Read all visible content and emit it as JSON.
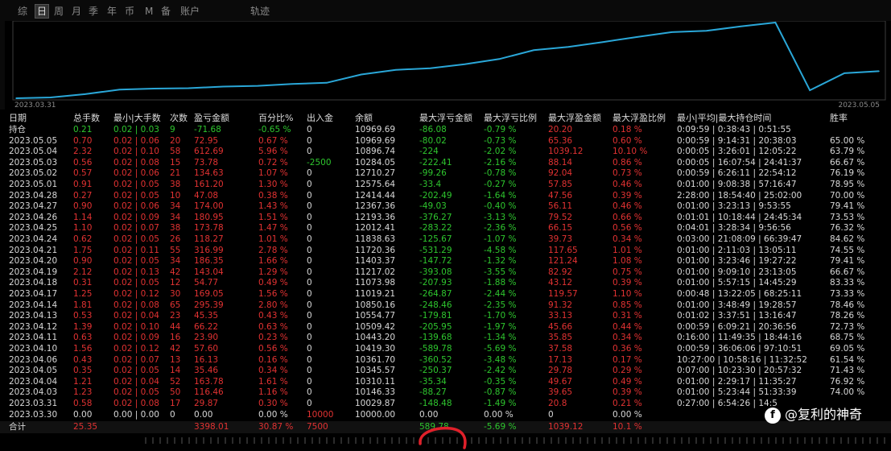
{
  "tabs": [
    "综",
    "日",
    "周",
    "月",
    "季",
    "年",
    "币",
    "M",
    "备",
    "账户",
    "轨迹"
  ],
  "active_tab": "日",
  "chart_data": {
    "type": "line",
    "x": [
      "2023.03.30",
      "2023.03.31",
      "2023.04.03",
      "2023.04.04",
      "2023.04.05",
      "2023.04.06",
      "2023.04.10",
      "2023.04.11",
      "2023.04.12",
      "2023.04.13",
      "2023.04.14",
      "2023.04.17",
      "2023.04.18",
      "2023.04.19",
      "2023.04.20",
      "2023.04.21",
      "2023.04.24",
      "2023.04.25",
      "2023.04.26",
      "2023.04.27",
      "2023.04.28",
      "2023.05.01",
      "2023.05.02",
      "2023.05.03",
      "2023.05.04",
      "2023.05.05"
    ],
    "values": [
      10000.0,
      10029.87,
      10146.33,
      10310.11,
      10345.57,
      10361.7,
      10419.3,
      10443.2,
      10509.42,
      10554.77,
      10850.16,
      11019.21,
      11073.98,
      11217.02,
      11403.37,
      11720.36,
      11838.63,
      12012.41,
      12193.36,
      12367.36,
      12414.44,
      12575.64,
      12710.27,
      10284.05,
      10896.74,
      10969.69
    ],
    "xlabel_start": "2023.03.31",
    "xlabel_end": "2023.05.05",
    "line_color": "#2aa7d8",
    "grid": false
  },
  "table": {
    "headers": [
      "日期",
      "总手数",
      "最小|大手数",
      "次数",
      "盈亏金额",
      "百分比%",
      "出入金",
      "余额",
      "最大浮亏金额",
      "最大浮亏比例",
      "最大浮盈金额",
      "最大浮盈比例",
      "最小|平均|最大持仓时间",
      "胜率"
    ],
    "rows": [
      {
        "date": "持仓",
        "lots": "0.21",
        "minmax": "0.02 | 0.03",
        "count": "9",
        "pnl": "-71.68",
        "pct": "-0.65 %",
        "flow": "0",
        "balance": "10969.69",
        "max_loss": "-86.08",
        "max_loss_pct": "-0.79 %",
        "max_gain": "20.20",
        "max_gain_pct": "0.18 %",
        "hold": "0:09:59 | 0:38:43 | 0:51:55",
        "win": "",
        "color": "green"
      },
      {
        "date": "2023.05.05",
        "lots": "0.70",
        "minmax": "0.02 | 0.06",
        "count": "20",
        "pnl": "72.95",
        "pct": "0.67 %",
        "flow": "0",
        "balance": "10969.69",
        "max_loss": "-80.02",
        "max_loss_pct": "-0.73 %",
        "max_gain": "65.36",
        "max_gain_pct": "0.60 %",
        "hold": "0:00:59 | 9:14:31 | 20:38:03",
        "win": "65.00 %",
        "color": "red"
      },
      {
        "date": "2023.05.04",
        "lots": "2.32",
        "minmax": "0.02 | 0.10",
        "count": "58",
        "pnl": "612.69",
        "pct": "5.96 %",
        "flow": "0",
        "balance": "10896.74",
        "max_loss": "-224",
        "max_loss_pct": "-2.02 %",
        "max_gain": "1039.12",
        "max_gain_pct": "10.10 %",
        "hold": "0:00:05 | 3:26:01 | 12:05:22",
        "win": "63.79 %",
        "color": "red"
      },
      {
        "date": "2023.05.03",
        "lots": "0.56",
        "minmax": "0.02 | 0.08",
        "count": "15",
        "pnl": "73.78",
        "pct": "0.72 %",
        "flow": "-2500",
        "balance": "10284.05",
        "max_loss": "-222.41",
        "max_loss_pct": "-2.16 %",
        "max_gain": "88.14",
        "max_gain_pct": "0.86 %",
        "hold": "0:00:05 | 16:07:54 | 24:41:37",
        "win": "66.67 %",
        "color": "red"
      },
      {
        "date": "2023.05.02",
        "lots": "0.57",
        "minmax": "0.02 | 0.06",
        "count": "21",
        "pnl": "134.63",
        "pct": "1.07 %",
        "flow": "0",
        "balance": "12710.27",
        "max_loss": "-99.26",
        "max_loss_pct": "-0.78 %",
        "max_gain": "92.04",
        "max_gain_pct": "0.73 %",
        "hold": "0:00:59 | 6:26:11 | 22:54:12",
        "win": "76.19 %",
        "color": "red"
      },
      {
        "date": "2023.05.01",
        "lots": "0.91",
        "minmax": "0.02 | 0.05",
        "count": "38",
        "pnl": "161.20",
        "pct": "1.30 %",
        "flow": "0",
        "balance": "12575.64",
        "max_loss": "-33.4",
        "max_loss_pct": "-0.27 %",
        "max_gain": "57.85",
        "max_gain_pct": "0.46 %",
        "hold": "0:01:00 | 9:08:38 | 57:16:47",
        "win": "78.95 %",
        "color": "red"
      },
      {
        "date": "2023.04.28",
        "lots": "0.27",
        "minmax": "0.02 | 0.05",
        "count": "10",
        "pnl": "47.08",
        "pct": "0.38 %",
        "flow": "0",
        "balance": "12414.44",
        "max_loss": "-202.49",
        "max_loss_pct": "-1.64 %",
        "max_gain": "47.56",
        "max_gain_pct": "0.39 %",
        "hold": "2:28:00 | 18:54:40 | 25:02:00",
        "win": "70.00 %",
        "color": "red"
      },
      {
        "date": "2023.04.27",
        "lots": "0.90",
        "minmax": "0.02 | 0.06",
        "count": "34",
        "pnl": "174.00",
        "pct": "1.43 %",
        "flow": "0",
        "balance": "12367.36",
        "max_loss": "-49.03",
        "max_loss_pct": "-0.40 %",
        "max_gain": "56.11",
        "max_gain_pct": "0.46 %",
        "hold": "0:01:00 | 3:23:13 | 9:53:55",
        "win": "79.41 %",
        "color": "red"
      },
      {
        "date": "2023.04.26",
        "lots": "1.14",
        "minmax": "0.02 | 0.09",
        "count": "34",
        "pnl": "180.95",
        "pct": "1.51 %",
        "flow": "0",
        "balance": "12193.36",
        "max_loss": "-376.27",
        "max_loss_pct": "-3.13 %",
        "max_gain": "79.52",
        "max_gain_pct": "0.66 %",
        "hold": "0:01:01 | 10:18:44 | 24:45:34",
        "win": "73.53 %",
        "color": "red"
      },
      {
        "date": "2023.04.25",
        "lots": "1.10",
        "minmax": "0.02 | 0.07",
        "count": "38",
        "pnl": "173.78",
        "pct": "1.47 %",
        "flow": "0",
        "balance": "12012.41",
        "max_loss": "-283.22",
        "max_loss_pct": "-2.36 %",
        "max_gain": "66.15",
        "max_gain_pct": "0.56 %",
        "hold": "0:04:01 | 3:28:34 | 9:56:56",
        "win": "76.32 %",
        "color": "red"
      },
      {
        "date": "2023.04.24",
        "lots": "0.62",
        "minmax": "0.02 | 0.05",
        "count": "26",
        "pnl": "118.27",
        "pct": "1.01 %",
        "flow": "0",
        "balance": "11838.63",
        "max_loss": "-125.67",
        "max_loss_pct": "-1.07 %",
        "max_gain": "39.73",
        "max_gain_pct": "0.34 %",
        "hold": "0:03:00 | 21:08:09 | 66:39:47",
        "win": "84.62 %",
        "color": "red"
      },
      {
        "date": "2023.04.21",
        "lots": "1.75",
        "minmax": "0.02 | 0.11",
        "count": "55",
        "pnl": "316.99",
        "pct": "2.78 %",
        "flow": "0",
        "balance": "11720.36",
        "max_loss": "-531.29",
        "max_loss_pct": "-4.58 %",
        "max_gain": "117.65",
        "max_gain_pct": "1.01 %",
        "hold": "0:01:00 | 2:11:03 | 13:05:11",
        "win": "74.55 %",
        "color": "red"
      },
      {
        "date": "2023.04.20",
        "lots": "0.90",
        "minmax": "0.02 | 0.05",
        "count": "34",
        "pnl": "186.35",
        "pct": "1.66 %",
        "flow": "0",
        "balance": "11403.37",
        "max_loss": "-147.72",
        "max_loss_pct": "-1.32 %",
        "max_gain": "121.24",
        "max_gain_pct": "1.08 %",
        "hold": "0:01:00 | 3:23:46 | 19:27:22",
        "win": "79.41 %",
        "color": "red"
      },
      {
        "date": "2023.04.19",
        "lots": "2.12",
        "minmax": "0.02 | 0.13",
        "count": "42",
        "pnl": "143.04",
        "pct": "1.29 %",
        "flow": "0",
        "balance": "11217.02",
        "max_loss": "-393.08",
        "max_loss_pct": "-3.55 %",
        "max_gain": "82.92",
        "max_gain_pct": "0.75 %",
        "hold": "0:01:00 | 9:09:10 | 23:13:05",
        "win": "66.67 %",
        "color": "red"
      },
      {
        "date": "2023.04.18",
        "lots": "0.31",
        "minmax": "0.02 | 0.05",
        "count": "12",
        "pnl": "54.77",
        "pct": "0.49 %",
        "flow": "0",
        "balance": "11073.98",
        "max_loss": "-207.93",
        "max_loss_pct": "-1.88 %",
        "max_gain": "43.12",
        "max_gain_pct": "0.39 %",
        "hold": "0:01:00 | 5:57:15 | 14:45:29",
        "win": "83.33 %",
        "color": "red"
      },
      {
        "date": "2023.04.17",
        "lots": "1.25",
        "minmax": "0.02 | 0.12",
        "count": "30",
        "pnl": "169.05",
        "pct": "1.56 %",
        "flow": "0",
        "balance": "11019.21",
        "max_loss": "-264.87",
        "max_loss_pct": "-2.44 %",
        "max_gain": "119.57",
        "max_gain_pct": "1.10 %",
        "hold": "0:00:48 | 13:22:05 | 68:25:11",
        "win": "73.33 %",
        "color": "red"
      },
      {
        "date": "2023.04.14",
        "lots": "1.81",
        "minmax": "0.02 | 0.08",
        "count": "65",
        "pnl": "295.39",
        "pct": "2.80 %",
        "flow": "0",
        "balance": "10850.16",
        "max_loss": "-248.46",
        "max_loss_pct": "-2.35 %",
        "max_gain": "91.32",
        "max_gain_pct": "0.85 %",
        "hold": "0:01:00 | 3:48:49 | 19:28:57",
        "win": "78.46 %",
        "color": "red"
      },
      {
        "date": "2023.04.13",
        "lots": "0.53",
        "minmax": "0.02 | 0.04",
        "count": "23",
        "pnl": "45.35",
        "pct": "0.43 %",
        "flow": "0",
        "balance": "10554.77",
        "max_loss": "-179.81",
        "max_loss_pct": "-1.70 %",
        "max_gain": "33.13",
        "max_gain_pct": "0.31 %",
        "hold": "0:01:02 | 3:37:51 | 13:16:47",
        "win": "78.26 %",
        "color": "red"
      },
      {
        "date": "2023.04.12",
        "lots": "1.39",
        "minmax": "0.02 | 0.10",
        "count": "44",
        "pnl": "66.22",
        "pct": "0.63 %",
        "flow": "0",
        "balance": "10509.42",
        "max_loss": "-205.95",
        "max_loss_pct": "-1.97 %",
        "max_gain": "45.66",
        "max_gain_pct": "0.44 %",
        "hold": "0:00:59 | 6:09:21 | 20:36:56",
        "win": "72.73 %",
        "color": "red"
      },
      {
        "date": "2023.04.11",
        "lots": "0.63",
        "minmax": "0.02 | 0.09",
        "count": "16",
        "pnl": "23.90",
        "pct": "0.23 %",
        "flow": "0",
        "balance": "10443.20",
        "max_loss": "-139.68",
        "max_loss_pct": "-1.34 %",
        "max_gain": "35.85",
        "max_gain_pct": "0.34 %",
        "hold": "0:16:00 | 11:49:35 | 18:44:16",
        "win": "68.75 %",
        "color": "red"
      },
      {
        "date": "2023.04.10",
        "lots": "1.56",
        "minmax": "0.02 | 0.12",
        "count": "42",
        "pnl": "57.60",
        "pct": "0.56 %",
        "flow": "0",
        "balance": "10419.30",
        "max_loss": "-589.78",
        "max_loss_pct": "-5.69 %",
        "max_gain": "37.58",
        "max_gain_pct": "0.36 %",
        "hold": "0:00:59 | 36:06:06 | 97:10:51",
        "win": "69.05 %",
        "color": "red"
      },
      {
        "date": "2023.04.06",
        "lots": "0.43",
        "minmax": "0.02 | 0.07",
        "count": "13",
        "pnl": "16.13",
        "pct": "0.16 %",
        "flow": "0",
        "balance": "10361.70",
        "max_loss": "-360.52",
        "max_loss_pct": "-3.48 %",
        "max_gain": "17.13",
        "max_gain_pct": "0.17 %",
        "hold": "10:27:00 | 10:58:16 | 11:32:52",
        "win": "61.54 %",
        "color": "red"
      },
      {
        "date": "2023.04.05",
        "lots": "0.35",
        "minmax": "0.02 | 0.05",
        "count": "14",
        "pnl": "35.46",
        "pct": "0.34 %",
        "flow": "0",
        "balance": "10345.57",
        "max_loss": "-250.37",
        "max_loss_pct": "-2.42 %",
        "max_gain": "29.78",
        "max_gain_pct": "0.29 %",
        "hold": "0:07:00 | 10:23:30 | 20:57:32",
        "win": "71.43 %",
        "color": "red"
      },
      {
        "date": "2023.04.04",
        "lots": "1.21",
        "minmax": "0.02 | 0.04",
        "count": "52",
        "pnl": "163.78",
        "pct": "1.61 %",
        "flow": "0",
        "balance": "10310.11",
        "max_loss": "-35.34",
        "max_loss_pct": "-0.35 %",
        "max_gain": "49.67",
        "max_gain_pct": "0.49 %",
        "hold": "0:01:00 | 2:29:17 | 11:35:27",
        "win": "76.92 %",
        "color": "red"
      },
      {
        "date": "2023.04.03",
        "lots": "1.23",
        "minmax": "0.02 | 0.05",
        "count": "50",
        "pnl": "116.46",
        "pct": "1.16 %",
        "flow": "0",
        "balance": "10146.33",
        "max_loss": "-88.27",
        "max_loss_pct": "-0.87 %",
        "max_gain": "39.65",
        "max_gain_pct": "0.39 %",
        "hold": "0:01:00 | 5:23:44 | 51:33:39",
        "win": "74.00 %",
        "color": "red"
      },
      {
        "date": "2023.03.31",
        "lots": "0.58",
        "minmax": "0.02 | 0.08",
        "count": "17",
        "pnl": "29.87",
        "pct": "0.30 %",
        "flow": "0",
        "balance": "10029.87",
        "max_loss": "-148.48",
        "max_loss_pct": "-1.49 %",
        "max_gain": "20.8",
        "max_gain_pct": "0.21 %",
        "hold": "0:27:00 | 6:54:26 | 14:5",
        "win": "",
        "color": "red"
      },
      {
        "date": "2023.03.30",
        "lots": "0.00",
        "minmax": "0.00 | 0.00",
        "count": "0",
        "pnl": "0.00",
        "pct": "0.00 %",
        "flow": "10000",
        "balance": "10000.00",
        "max_loss": "0.00",
        "max_loss_pct": "0.00 %",
        "max_gain": "0",
        "max_gain_pct": "0.00 %",
        "hold": "",
        "win": "",
        "color": "white"
      }
    ],
    "total": {
      "date": "合计",
      "lots": "25.35",
      "minmax": "",
      "count": "",
      "pnl": "3398.01",
      "pct": "30.87 %",
      "flow": "7500",
      "balance": "",
      "max_loss": "589.78",
      "max_loss_pct": "-5.69 %",
      "max_gain": "1039.12",
      "max_gain_pct": "10.1 %",
      "hold": "",
      "win": ""
    }
  },
  "watermark": {
    "logo": "f",
    "text": "@复利的神奇"
  },
  "colors": {
    "profit": "#e23232",
    "loss": "#2ec62e",
    "line": "#2aa7d8",
    "annotation": "#e0202a"
  }
}
